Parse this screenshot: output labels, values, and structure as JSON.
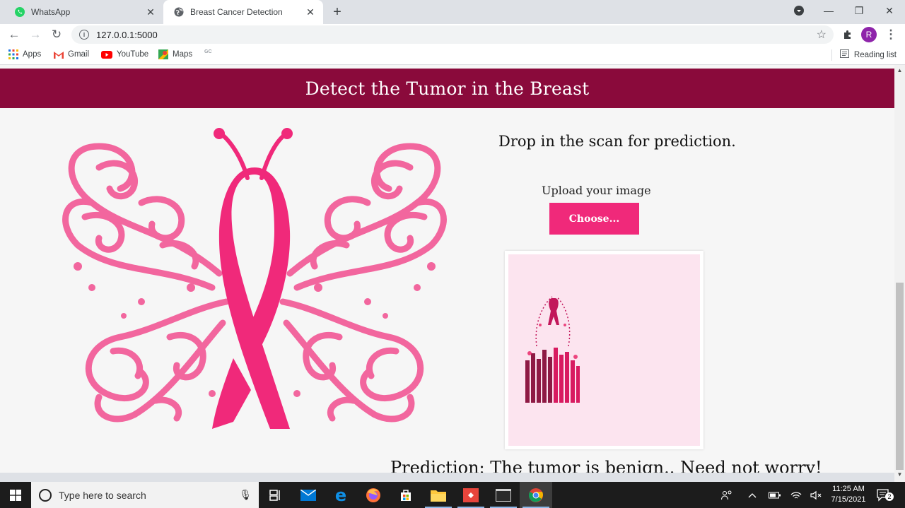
{
  "browser": {
    "tabs": [
      {
        "title": "WhatsApp",
        "icon": "whatsapp-icon"
      },
      {
        "title": "Breast Cancer Detection",
        "icon": "globe-icon"
      }
    ],
    "url": "127.0.0.1:5000",
    "bookmarks": [
      {
        "label": "Apps",
        "icon": "apps-grid-icon"
      },
      {
        "label": "Gmail",
        "icon": "gmail-icon"
      },
      {
        "label": "YouTube",
        "icon": "youtube-icon"
      },
      {
        "label": "Maps",
        "icon": "maps-icon"
      },
      {
        "label": "",
        "icon": "gc-icon"
      }
    ],
    "gc_label": "GC",
    "reading_list": "Reading list",
    "profile_initial": "R"
  },
  "page": {
    "title": "Detect the Tumor in the Breast",
    "drop_text": "Drop in the scan for prediction.",
    "upload_label": "Upload your image",
    "choose_button": "Choose...",
    "prediction": "Prediction: The tumor is benign.. Need not worry!"
  },
  "taskbar": {
    "search_placeholder": "Type here to search",
    "time": "11:25 AM",
    "date": "7/15/2021",
    "notification_count": "2"
  },
  "colors": {
    "header": "#8a0a3b",
    "accent": "#f0297a",
    "butterfly": "#f2669e",
    "ribbon": "#f0297a"
  }
}
